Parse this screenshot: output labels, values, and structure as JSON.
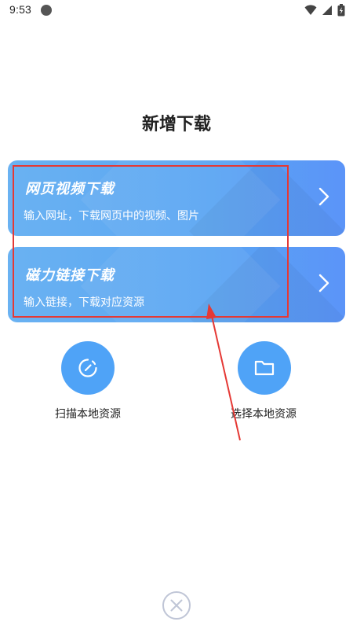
{
  "status_bar": {
    "time": "9:53"
  },
  "page": {
    "title": "新增下载"
  },
  "cards": [
    {
      "title": "网页视频下载",
      "subtitle": "输入网址，下载网页中的视频、图片"
    },
    {
      "title": "磁力链接下载",
      "subtitle": "输入链接，下载对应资源"
    }
  ],
  "actions": [
    {
      "label": "扫描本地资源",
      "icon": "scan-icon"
    },
    {
      "label": "选择本地资源",
      "icon": "folder-icon"
    }
  ],
  "colors": {
    "card_gradient_start": "#6AB2F2",
    "card_gradient_end": "#5B94F8",
    "action_blue": "#4FA3F7",
    "annotation_red": "#E53935",
    "close_gray": "#BFC5D6"
  }
}
